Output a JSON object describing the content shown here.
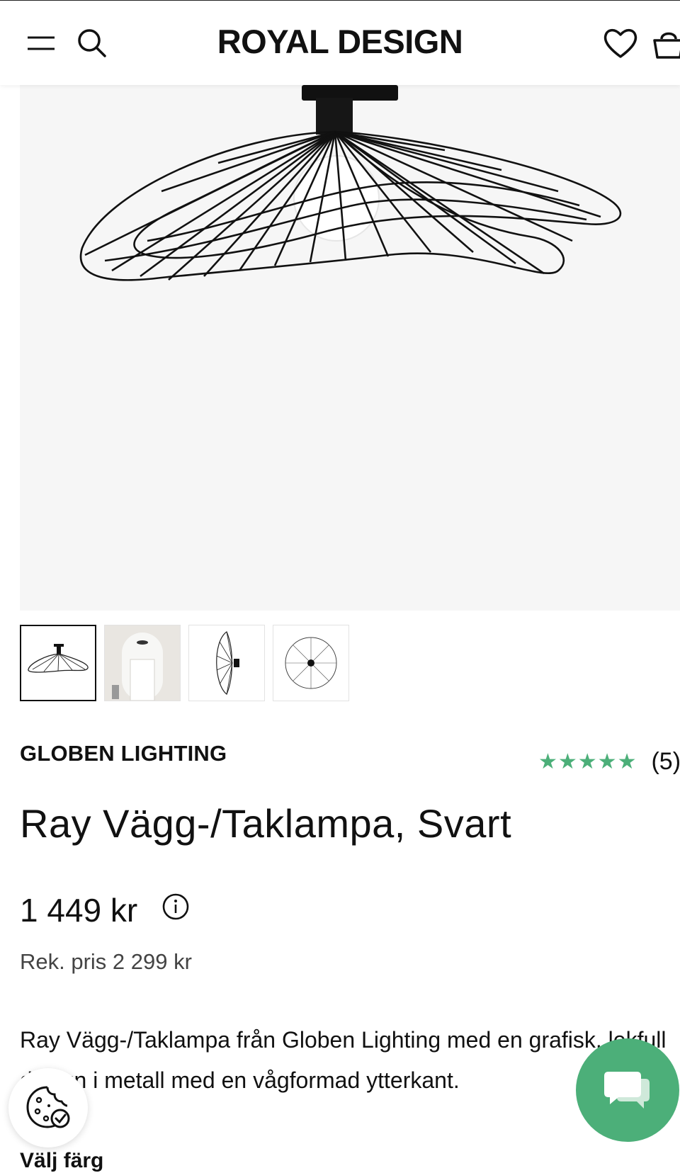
{
  "header": {
    "logo": "ROYAL DESIGN",
    "icons": [
      "menu-icon",
      "search-icon",
      "heart-icon",
      "cart-icon"
    ]
  },
  "gallery": {
    "thumbnails": [
      "product-front",
      "room-photo",
      "product-side",
      "product-top"
    ],
    "active_index": 0
  },
  "product": {
    "brand": "GLOBEN LIGHTING",
    "rating_stars": "★★★★★",
    "rating_value": 5,
    "rating_count": "(5)",
    "title": "Ray Vägg-/Taklampa, Svart",
    "price": "1 449 kr",
    "rek_price": "Rek. pris 2 299 kr",
    "description": "Ray Vägg-/Taklampa från Globen Lighting med en grafisk, lekfull design i metall med en vågformad ytterkant.",
    "choose_color": "Välj färg"
  },
  "colors": {
    "accent_green": "#4caf79",
    "hero_bg": "#f6f6f6",
    "text": "#111111"
  }
}
